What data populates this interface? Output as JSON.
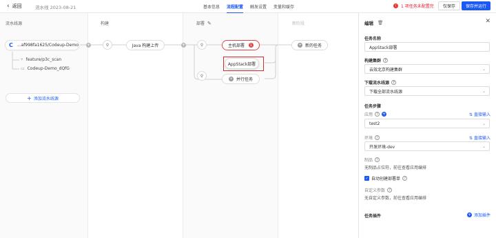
{
  "header": {
    "back_label": "返回",
    "pipeline_name": "流水线 2023-08-21",
    "tabs": [
      {
        "label": "基本信息",
        "active": false
      },
      {
        "label": "流程配置",
        "active": true
      },
      {
        "label": "触发设置",
        "active": false
      },
      {
        "label": "变量和缓存",
        "active": false
      }
    ],
    "warning_text": "1 项任务未配置完",
    "save_only_label": "仅保存",
    "save_run_label": "保存并运行"
  },
  "canvas": {
    "columns": [
      {
        "title": "流水线源"
      },
      {
        "title": "构建"
      },
      {
        "title": "部署"
      },
      {
        "title": "新阶段"
      }
    ],
    "source": {
      "repo_label": "...af998fa1625/Codeup-Demo",
      "branch": "feature/p3c_scan",
      "repo_name": "Codeup-Demo_dQfG",
      "add_source_label": "添加流水线源"
    },
    "build": {
      "job_label": "Java 构建上传"
    },
    "deploy": {
      "host_deploy_label": "主机部署",
      "host_deploy_badge": "1",
      "appstack_label": "AppStack部署",
      "parallel_label": "并行任务"
    },
    "new_stage": {
      "new_task_label": "新的任务"
    }
  },
  "panel": {
    "title": "编辑",
    "task_name_label": "任务名称",
    "task_name_value": "AppStack部署",
    "cluster_label": "构建集群",
    "cluster_value": "云效北京构建集群",
    "download_label": "下载流水线源",
    "download_value": "下载全部流水线源",
    "steps_label": "任务步骤",
    "app_label": "应用",
    "app_link": "直接输入",
    "app_value": "test2",
    "env_label": "环境",
    "env_link": "直接输入",
    "env_value": "开发环境-dev",
    "artifact_label": "制品",
    "artifact_help": "无制品占位符，前往查看应用编排",
    "auto_create_label": "自动创建部署单",
    "custom_params_label": "自定义参数",
    "custom_params_help": "无自定义参数，前往查看应用编排",
    "plugins_label": "任务插件",
    "add_plugin_label": "添加插件"
  }
}
